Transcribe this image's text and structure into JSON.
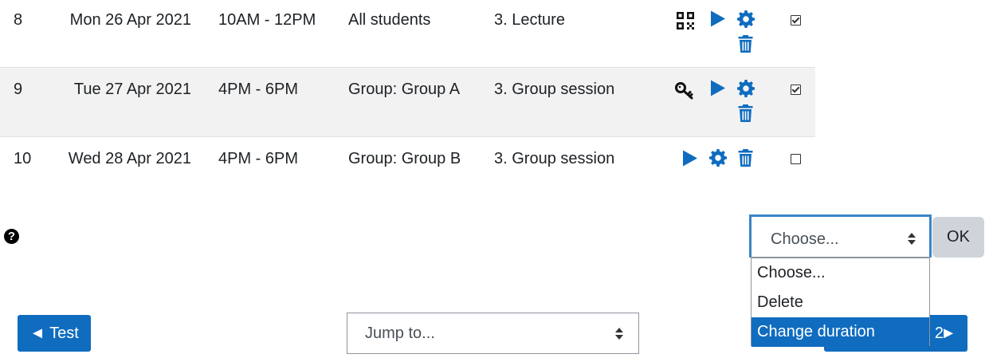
{
  "rows": [
    {
      "num": "8",
      "date": "Mon 26 Apr 2021",
      "time": "10AM - 12PM",
      "group": "All students",
      "type": "3. Lecture",
      "checked": true
    },
    {
      "num": "9",
      "date": "Tue 27 Apr 2021",
      "time": "4PM - 6PM",
      "group": "Group: Group A",
      "type": "3. Group session",
      "checked": true
    },
    {
      "num": "10",
      "date": "Wed 28 Apr 2021",
      "time": "4PM - 6PM",
      "group": "Group: Group B",
      "type": "3. Group session",
      "checked": false
    }
  ],
  "icons": {
    "qr": "qr-code-icon",
    "key": "key-icon",
    "play": "play-icon",
    "gear": "gear-icon",
    "trash": "trash-icon",
    "help": "help-icon"
  },
  "colors": {
    "accent": "#0f6cbf",
    "selected": "#0f6cbf",
    "row_alt": "#f2f2f2"
  },
  "help": {
    "glyph": "?"
  },
  "bulk_action": {
    "selected": "Choose...",
    "ok_label": "OK",
    "options": [
      "Choose...",
      "Delete",
      "Change duration"
    ],
    "highlighted": "Change duration"
  },
  "pager": {
    "prev_label": "◄ Test",
    "jump_placeholder": "Jump to...",
    "next_partial": "2",
    "next_arrow": "►"
  }
}
